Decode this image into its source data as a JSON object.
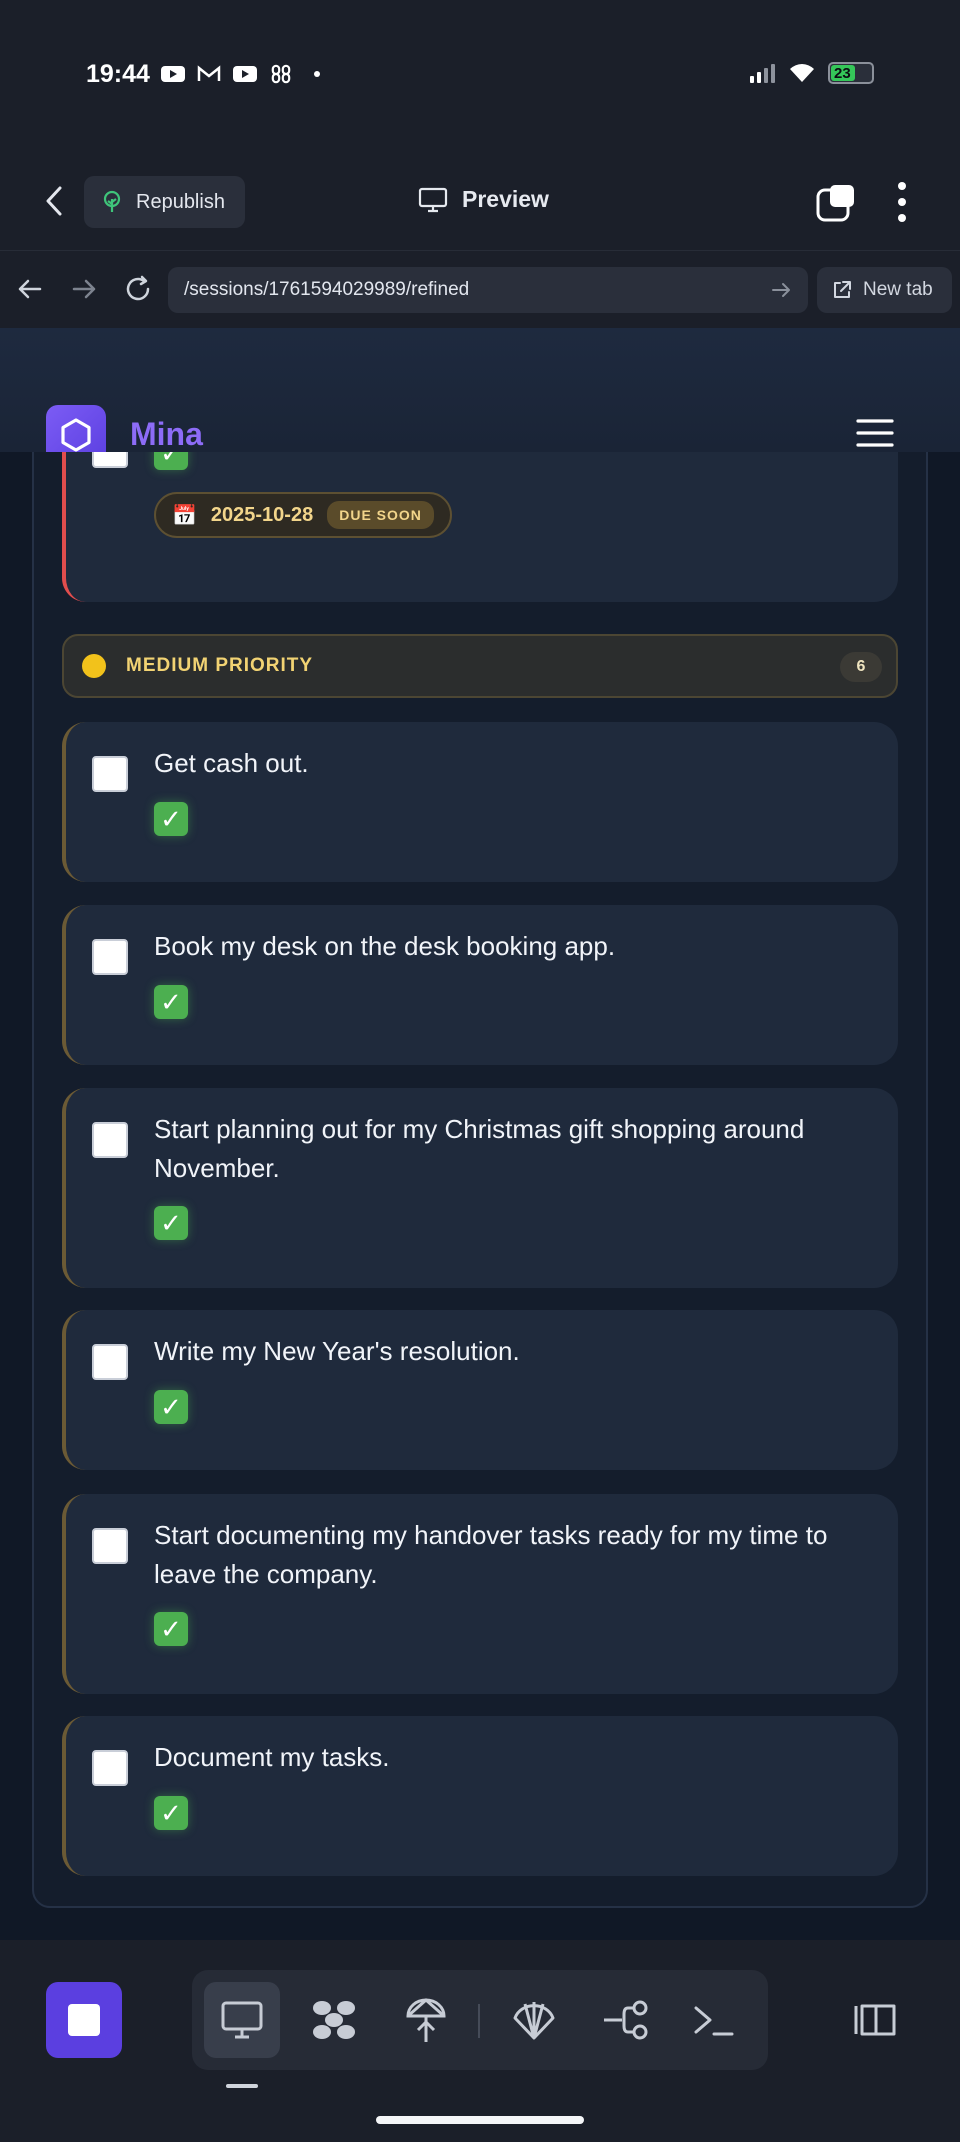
{
  "status_bar": {
    "time": "19:44",
    "battery": "23",
    "notification_icons": [
      "youtube-icon",
      "gmail-icon",
      "youtube-icon",
      "slack-icon",
      "dot-icon"
    ],
    "system_icons": [
      "signal-icon",
      "wifi-icon",
      "battery-charging-icon"
    ]
  },
  "app_toolbar": {
    "back_icon": "chevron-left-icon",
    "republish_label": "Republish",
    "preview_label": "Preview",
    "tabs_icon": "tabs-icon",
    "more_icon": "more-vertical-icon"
  },
  "url_bar": {
    "url": "/sessions/1761594029989/refined",
    "new_tab_label": "New tab"
  },
  "app_header": {
    "brand": "Mina",
    "logo_icon": "hexagon-icon",
    "menu_icon": "hamburger-icon"
  },
  "high_task": {
    "due_date": "2025-10-28",
    "due_badge": "DUE SOON",
    "calendar_icon": "📅",
    "tick_emoji": "✓"
  },
  "section": {
    "title": "MEDIUM PRIORITY",
    "count": "6",
    "accent": "#f2c21b"
  },
  "tasks": [
    {
      "text": "Get cash out.",
      "tick": "✓"
    },
    {
      "text": "Book my desk on the desk booking app.",
      "tick": "✓"
    },
    {
      "text": "Start planning out for my Christmas gift shopping around November.",
      "tick": "✓"
    },
    {
      "text": "Write my New Year's resolution.",
      "tick": "✓"
    },
    {
      "text": "Start documenting my handover tasks ready for my time to leave the company.",
      "tick": "✓"
    },
    {
      "text": "Document my tasks.",
      "tick": "✓"
    }
  ],
  "bottom_nav": {
    "tools": [
      "desktop-icon",
      "apps-icon",
      "deploy-icon",
      "shell-icon",
      "git-branch-icon",
      "terminal-icon"
    ],
    "active_tool": "desktop-icon",
    "brand_color": "#5b3fe0"
  }
}
